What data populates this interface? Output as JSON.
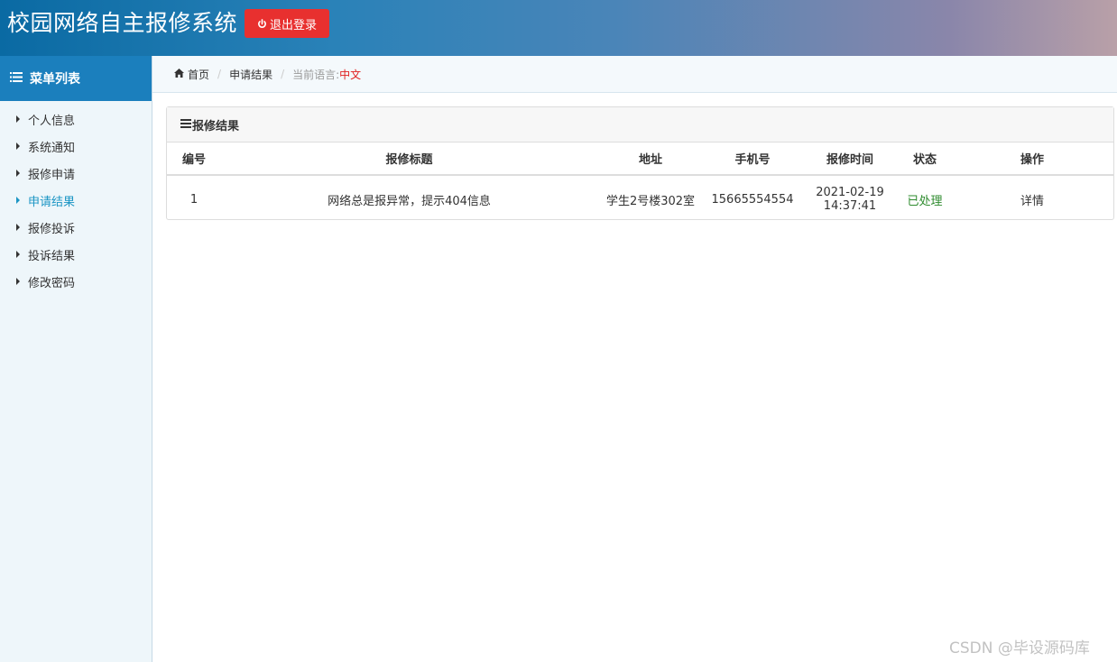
{
  "header": {
    "app_title": "校园网络自主报修系统",
    "logout_label": "退出登录"
  },
  "sidebar": {
    "title": "菜单列表",
    "items": [
      {
        "label": "个人信息"
      },
      {
        "label": "系统通知"
      },
      {
        "label": "报修申请"
      },
      {
        "label": "申请结果"
      },
      {
        "label": "报修投诉"
      },
      {
        "label": "投诉结果"
      },
      {
        "label": "修改密码"
      }
    ],
    "active_index": 3
  },
  "breadcrumb": {
    "home": "首页",
    "current": "申请结果",
    "language_label": "当前语言:",
    "language_value": "中文"
  },
  "panel": {
    "title": "报修结果",
    "columns": [
      "编号",
      "报修标题",
      "地址",
      "手机号",
      "报修时间",
      "状态",
      "操作"
    ],
    "rows": [
      {
        "id": "1",
        "title": "网络总是报异常，提示404信息",
        "address": "学生2号楼302室",
        "phone": "15665554554",
        "date": "2021-02-19",
        "time": "14:37:41",
        "status": "已处理",
        "action": "详情"
      }
    ]
  },
  "watermark": "CSDN @毕设源码库",
  "colors": {
    "header_gradient_start": "#0a6aa3",
    "header_gradient_end": "#b9a0a8",
    "logout_red": "#e8302f",
    "sidebar_header": "#1b7fbd",
    "active_menu": "#1b95c4",
    "status_green": "#2e8b2e",
    "language_red": "#e02020"
  }
}
